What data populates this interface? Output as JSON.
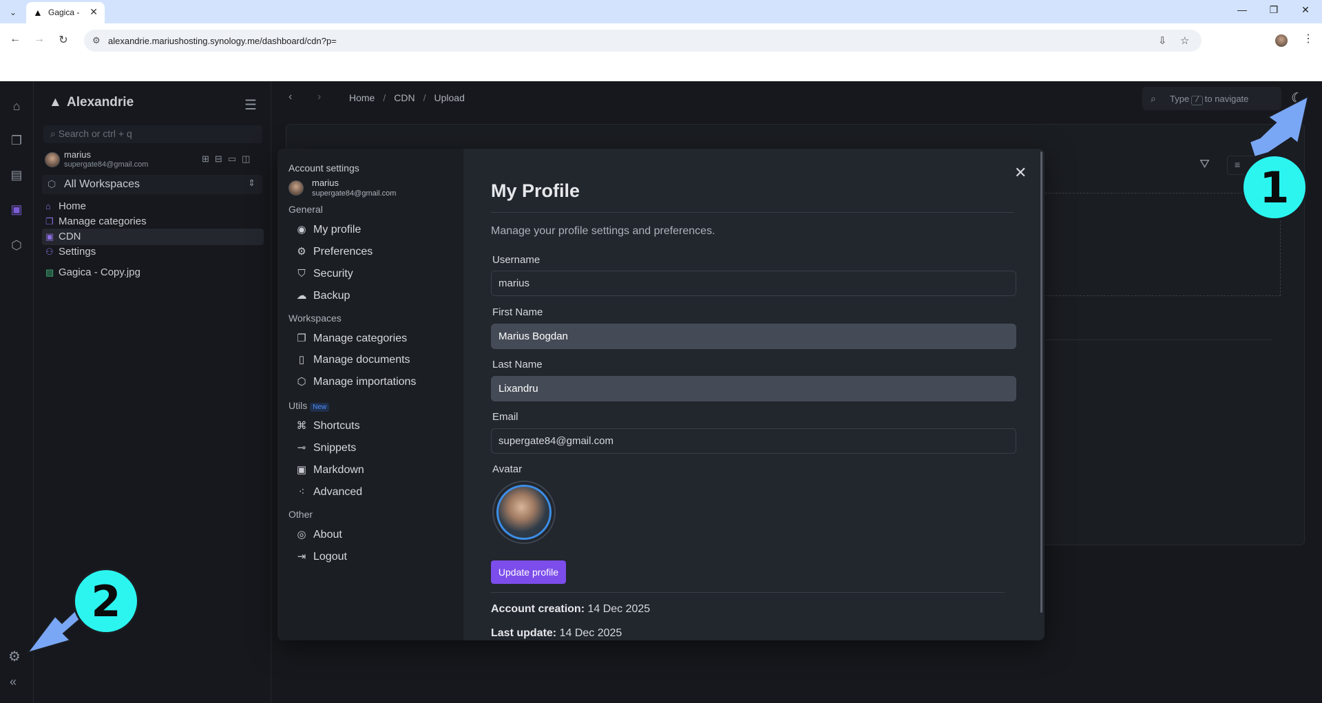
{
  "browser": {
    "tab_title": "Gagica -",
    "url": "alexandrie.mariushosting.synology.me/dashboard/cdn?p="
  },
  "sidebar": {
    "brand": "Alexandrie",
    "search_placeholder": "Search or ctrl + q",
    "user": {
      "name": "marius",
      "email": "supergate84@gmail.com"
    },
    "workspace": "All Workspaces",
    "items": [
      {
        "label": "Home"
      },
      {
        "label": "Manage categories"
      },
      {
        "label": "CDN"
      },
      {
        "label": "Settings"
      }
    ],
    "file": "Gagica - Copy.jpg"
  },
  "topbar": {
    "breadcrumbs": [
      "Home",
      "CDN",
      "Upload"
    ],
    "quick_nav": {
      "prefix": "Type",
      "key": "/",
      "suffix": "to navigate"
    }
  },
  "modal": {
    "title": "Account settings",
    "user": {
      "name": "marius",
      "email": "supergate84@gmail.com"
    },
    "sections": {
      "general": "General",
      "workspaces": "Workspaces",
      "utils": "Utils",
      "utils_badge": "New",
      "other": "Other"
    },
    "menu": {
      "my_profile": "My profile",
      "preferences": "Preferences",
      "security": "Security",
      "backup": "Backup",
      "manage_categories": "Manage categories",
      "manage_documents": "Manage documents",
      "manage_importations": "Manage importations",
      "shortcuts": "Shortcuts",
      "snippets": "Snippets",
      "markdown": "Markdown",
      "advanced": "Advanced",
      "about": "About",
      "logout": "Logout"
    },
    "profile": {
      "heading": "My Profile",
      "description": "Manage your profile settings and preferences.",
      "username_label": "Username",
      "username": "marius",
      "first_name_label": "First Name",
      "first_name": "Marius Bogdan",
      "last_name_label": "Last Name",
      "last_name": "Lixandru",
      "email_label": "Email",
      "email": "supergate84@gmail.com",
      "avatar_label": "Avatar",
      "update_button": "Update profile",
      "creation_label": "Account creation:",
      "creation_value": "14 Dec 2025",
      "update_label": "Last update:",
      "update_value": "14 Dec 2025"
    }
  },
  "annotations": {
    "badge_1": "1",
    "badge_2": "2"
  },
  "colors": {
    "accent": "#7c4dea",
    "badge": "#2cf5f0",
    "arrow": "#7aa7f5"
  }
}
